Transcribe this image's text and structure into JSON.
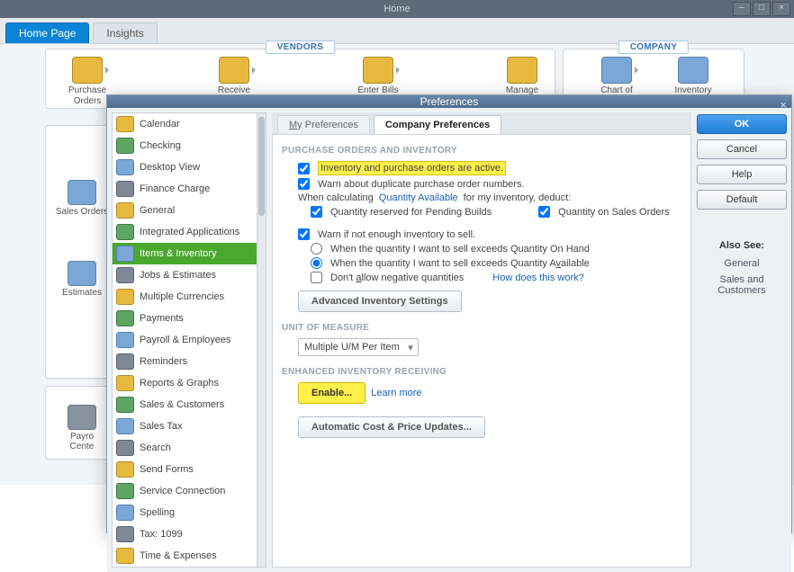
{
  "window_title": "Home",
  "tabs": {
    "home": "Home Page",
    "insights": "Insights"
  },
  "vendors": {
    "label": "VENDORS",
    "icons": {
      "po": "Purchase Orders",
      "receive": "Receive",
      "enter_bills": "Enter Bills",
      "manage": "Manage"
    }
  },
  "company": {
    "label": "COMPANY",
    "icons": {
      "coa": "Chart of",
      "inventory": "Inventory"
    }
  },
  "left_flow": {
    "sales_orders": "Sales Orders",
    "estimates": "Estimates",
    "payroll": "Payro",
    "center": "Cente"
  },
  "dialog": {
    "title": "Preferences",
    "categories": [
      "Calendar",
      "Checking",
      "Desktop View",
      "Finance Charge",
      "General",
      "Integrated Applications",
      "Items & Inventory",
      "Jobs & Estimates",
      "Multiple Currencies",
      "Payments",
      "Payroll & Employees",
      "Reminders",
      "Reports & Graphs",
      "Sales & Customers",
      "Sales Tax",
      "Search",
      "Send Forms",
      "Service Connection",
      "Spelling",
      "Tax: 1099",
      "Time & Expenses"
    ],
    "selected_category_index": 6,
    "tabs": {
      "my": {
        "prefix": "M",
        "rest": "y Preferences"
      },
      "company": "Company Preferences"
    },
    "sections": {
      "s1": "PURCHASE ORDERS AND INVENTORY",
      "s2": "UNIT OF MEASURE",
      "s3": "ENHANCED INVENTORY RECEIVING"
    },
    "fields": {
      "active": "Inventory and purchase orders are active.",
      "warn_dup": "Warn about duplicate purchase order numbers.",
      "calc_prefix": "When calculating",
      "qty_avail_link": "Quantity Available",
      "calc_suffix": "for my inventory, deduct:",
      "pending": "Quantity reserved for Pending Builds",
      "on_so": "Quantity on Sales Orders",
      "warn_sell": "Warn if not enough inventory to sell.",
      "r1": "When the quantity I want to sell exceeds Quantity On Hand",
      "r2_pre": "When the quantity I want to sell exceeds Quantity A",
      "r2_ul": "v",
      "r2_post": "ailable",
      "neg_pre": "Don't ",
      "neg_ul": "a",
      "neg_post": "llow negative quantities",
      "how_link": "How does this work?",
      "adv_btn": "Advanced Inventory Settings",
      "uom_value": "Multiple U/M Per Item",
      "enable_btn": "Enable...",
      "learn_link": "Learn more",
      "auto_btn": "Automatic Cost & Price Updates..."
    },
    "buttons": {
      "ok": "OK",
      "cancel": "Cancel",
      "help": "Help",
      "default": "Default"
    },
    "also_see": {
      "title": "Also See:",
      "items": [
        "General",
        "Sales and Customers"
      ]
    }
  }
}
